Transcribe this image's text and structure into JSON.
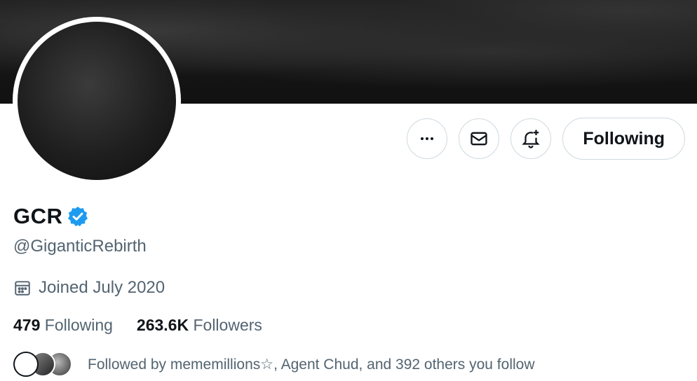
{
  "profile": {
    "name": "GCR",
    "handle": "@GiganticRebirth",
    "joined": "Joined July 2020",
    "following_count": "479",
    "following_label": "Following",
    "followers_count": "263.6K",
    "followers_label": "Followers",
    "followed_by": "Followed by mememillions☆, Agent Chud, and 392 others you follow"
  },
  "actions": {
    "more_icon": "more-icon",
    "message_icon": "mail-icon",
    "notify_icon": "bell-plus-icon",
    "follow_label": "Following"
  },
  "colors": {
    "verified": "#1d9bf0",
    "secondary_text": "#536471",
    "border": "#cfd9de"
  }
}
